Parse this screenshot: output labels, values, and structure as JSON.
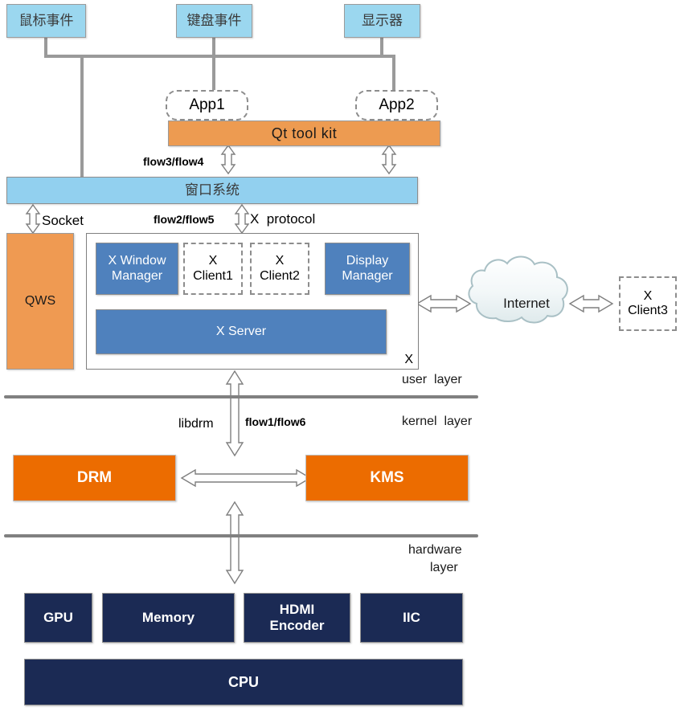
{
  "diagram": {
    "title": "Linux graphics stack layered architecture",
    "colors": {
      "event_box": "#9bd7ef",
      "window_system": "#92d0ef",
      "qt_toolkit": "#ed9b51",
      "qws": "#ef9a52",
      "x_component": "#4f81bd",
      "drm_kms": "#ec6c00",
      "hardware": "#1b2a54",
      "connector_line": "#9a9a9a",
      "separator": "#808080",
      "arrow_outline": "#7f7f7f"
    }
  },
  "events": [
    {
      "label": "鼠标事件",
      "name": "mouse-event"
    },
    {
      "label": "键盘事件",
      "name": "keyboard-event"
    },
    {
      "label": "显示器",
      "name": "display-monitor"
    }
  ],
  "apps": [
    {
      "label": "App1"
    },
    {
      "label": "App2"
    }
  ],
  "toolkit": {
    "label": "Qt  tool  kit"
  },
  "window_system": {
    "label": "窗口系统"
  },
  "qws": {
    "label": "QWS"
  },
  "x_system": {
    "corner_label": "X",
    "components": [
      {
        "label_line1": "X  Window",
        "label_line2": "Manager",
        "style": "solid"
      },
      {
        "label_line1": "X",
        "label_line2": "Client1",
        "style": "dashed"
      },
      {
        "label_line1": "X",
        "label_line2": "Client2",
        "style": "dashed"
      },
      {
        "label_line1": "Display",
        "label_line2": "Manager",
        "style": "solid"
      }
    ],
    "server": {
      "label": "X  Server"
    }
  },
  "internet": {
    "label": "Internet"
  },
  "remote_client": {
    "label_line1": "X",
    "label_line2": "Client3"
  },
  "kernel": [
    {
      "label": "DRM"
    },
    {
      "label": "KMS"
    }
  ],
  "hardware": {
    "blocks": [
      {
        "label_line1": "GPU",
        "label_line2": ""
      },
      {
        "label_line1": "Memory",
        "label_line2": ""
      },
      {
        "label_line1": "HDMI",
        "label_line2": "Encoder"
      },
      {
        "label_line1": "IIC",
        "label_line2": ""
      }
    ],
    "cpu": {
      "label": "CPU"
    }
  },
  "flow_labels": {
    "flow34": "flow3/flow4",
    "flow25": "flow2/flow5",
    "flow16": "flow1/flow6",
    "socket": "Socket",
    "x_protocol": "X  protocol",
    "libdrm": "libdrm"
  },
  "layers": {
    "user": "user  layer",
    "kernel": "kernel  layer",
    "hardware_line1": "hardware",
    "hardware_line2": "layer"
  }
}
